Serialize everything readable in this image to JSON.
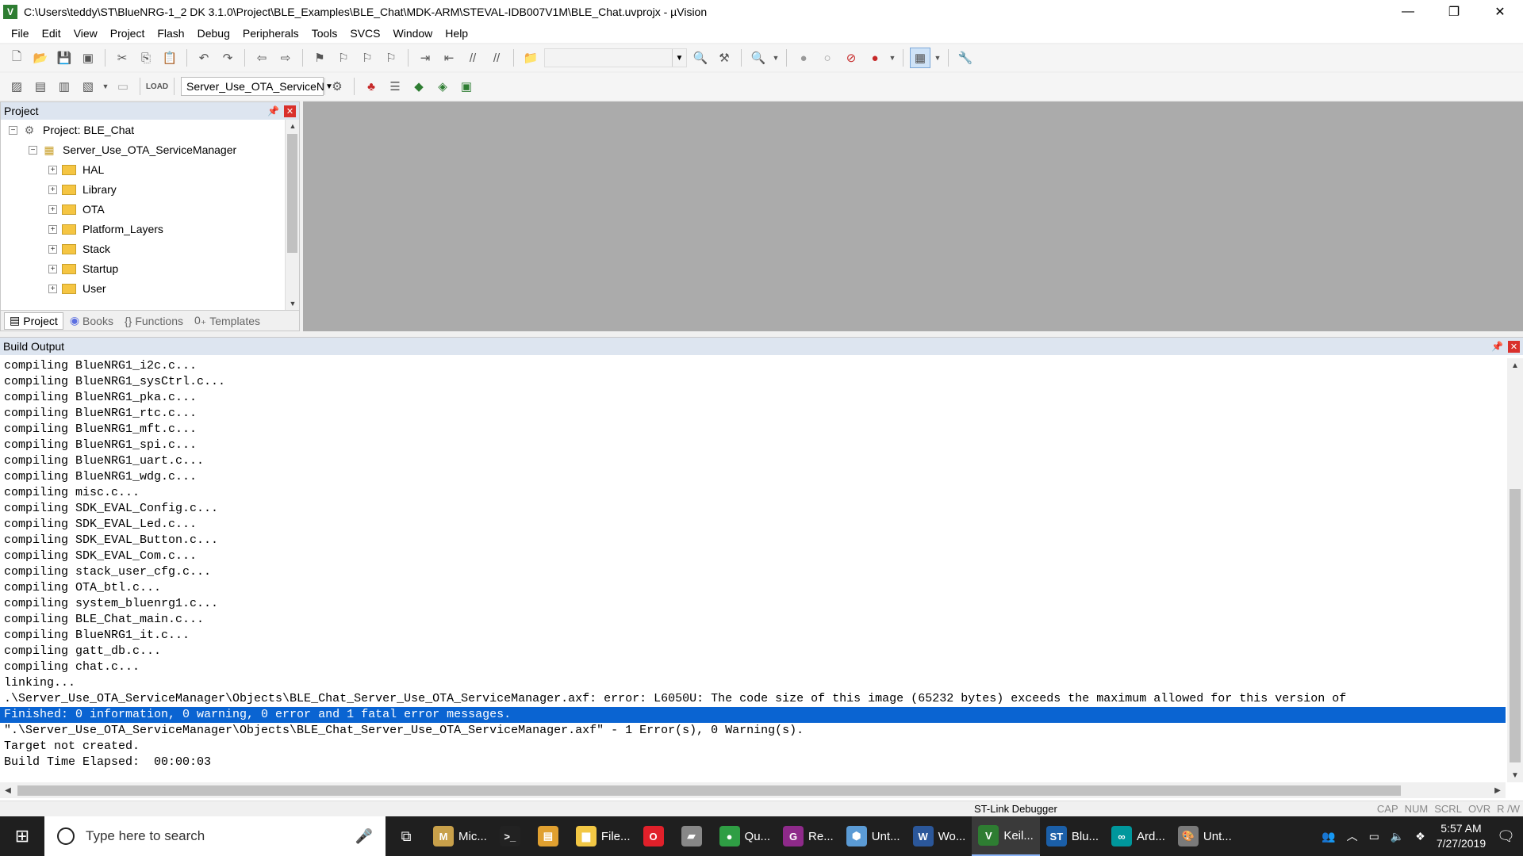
{
  "window": {
    "title": "C:\\Users\\teddy\\ST\\BlueNRG-1_2 DK 3.1.0\\Project\\BLE_Examples\\BLE_Chat\\MDK-ARM\\STEVAL-IDB007V1M\\BLE_Chat.uvprojx - µVision",
    "minimize": "—",
    "maximize": "❐",
    "close": "✕"
  },
  "menu": [
    "File",
    "Edit",
    "View",
    "Project",
    "Flash",
    "Debug",
    "Peripherals",
    "Tools",
    "SVCS",
    "Window",
    "Help"
  ],
  "toolbar2": {
    "target_combo": "Server_Use_OTA_ServiceN"
  },
  "project_pane": {
    "title": "Project",
    "root": "Project: BLE_Chat",
    "target": "Server_Use_OTA_ServiceManager",
    "groups": [
      "HAL",
      "Library",
      "OTA",
      "Platform_Layers",
      "Stack",
      "Startup",
      "User"
    ],
    "tabs": [
      "Project",
      "Books",
      "Functions",
      "Templates"
    ]
  },
  "build_output": {
    "title": "Build Output",
    "lines": [
      "compiling BlueNRG1_i2c.c...",
      "compiling BlueNRG1_sysCtrl.c...",
      "compiling BlueNRG1_pka.c...",
      "compiling BlueNRG1_rtc.c...",
      "compiling BlueNRG1_mft.c...",
      "compiling BlueNRG1_spi.c...",
      "compiling BlueNRG1_uart.c...",
      "compiling BlueNRG1_wdg.c...",
      "compiling misc.c...",
      "compiling SDK_EVAL_Config.c...",
      "compiling SDK_EVAL_Led.c...",
      "compiling SDK_EVAL_Button.c...",
      "compiling SDK_EVAL_Com.c...",
      "compiling stack_user_cfg.c...",
      "compiling OTA_btl.c...",
      "compiling system_bluenrg1.c...",
      "compiling BLE_Chat_main.c...",
      "compiling BlueNRG1_it.c...",
      "compiling gatt_db.c...",
      "compiling chat.c...",
      "linking...",
      ".\\Server_Use_OTA_ServiceManager\\Objects\\BLE_Chat_Server_Use_OTA_ServiceManager.axf: error: L6050U: The code size of this image (65232 bytes) exceeds the maximum allowed for this version of",
      "Finished: 0 information, 0 warning, 0 error and 1 fatal error messages.",
      "\".\\Server_Use_OTA_ServiceManager\\Objects\\BLE_Chat_Server_Use_OTA_ServiceManager.axf\" - 1 Error(s), 0 Warning(s).",
      "Target not created.",
      "Build Time Elapsed:  00:00:03"
    ],
    "highlighted_index": 22
  },
  "status": {
    "debugger": "ST-Link Debugger",
    "keys": [
      "CAP",
      "NUM",
      "SCRL",
      "OVR",
      "R /W"
    ]
  },
  "taskbar": {
    "search_placeholder": "Type here to search",
    "apps": [
      {
        "label": "Mic...",
        "icon": "M",
        "color": "#c8a04a"
      },
      {
        "label": "",
        "icon": ">_",
        "color": "#222222"
      },
      {
        "label": "",
        "icon": "▤",
        "color": "#e0a030"
      },
      {
        "label": "File...",
        "icon": "▆",
        "color": "#f2c744"
      },
      {
        "label": "",
        "icon": "O",
        "color": "#e0202a"
      },
      {
        "label": "",
        "icon": "▰",
        "color": "#888888"
      },
      {
        "label": "Qu...",
        "icon": "●",
        "color": "#2f9e44"
      },
      {
        "label": "Re...",
        "icon": "G",
        "color": "#8e2a8a"
      },
      {
        "label": "Unt...",
        "icon": "⬢",
        "color": "#5b9bd5"
      },
      {
        "label": "Wo...",
        "icon": "W",
        "color": "#2b579a"
      },
      {
        "label": "Keil...",
        "icon": "V",
        "color": "#2e7d32"
      },
      {
        "label": "Blu...",
        "icon": "ST",
        "color": "#1b5fa8"
      },
      {
        "label": "Ard...",
        "icon": "∞",
        "color": "#00979c"
      },
      {
        "label": "Unt...",
        "icon": "🎨",
        "color": "#7a7a7a"
      }
    ],
    "active_index": 10,
    "time": "5:57 AM",
    "date": "7/27/2019"
  }
}
